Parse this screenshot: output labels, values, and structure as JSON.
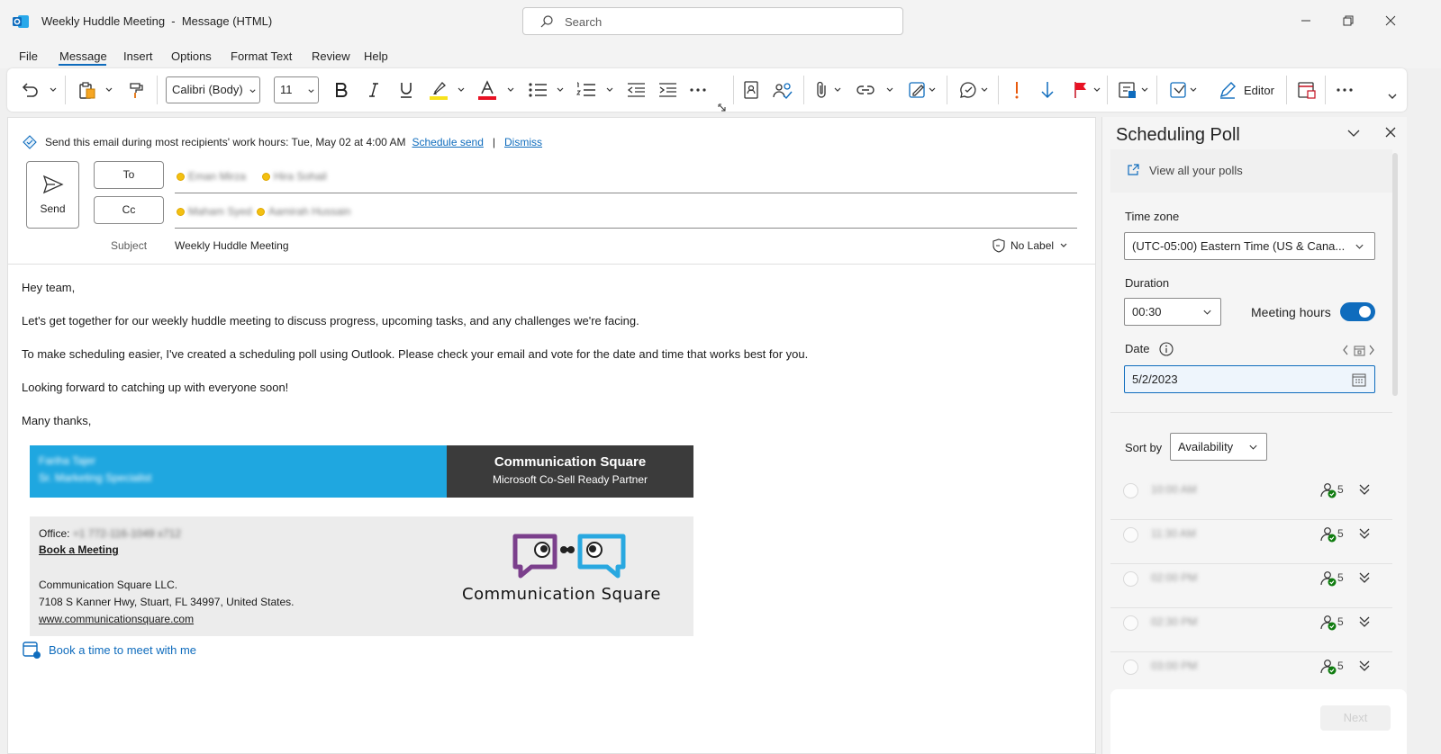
{
  "window": {
    "title": "Weekly Huddle Meeting  -  Message (HTML)",
    "search_placeholder": "Search"
  },
  "menu": {
    "tabs": [
      "File",
      "Message",
      "Insert",
      "Options",
      "Format Text",
      "Review",
      "Help"
    ],
    "active_tab": "Message"
  },
  "ribbon": {
    "font_name": "Calibri (Body)",
    "font_size": "11",
    "editor_label": "Editor",
    "highlight_color": "#f7e21c",
    "font_color": "#e81123"
  },
  "compose": {
    "send_suggestion": "Send this email during most recipients' work hours: Tue, May 02 at 4:00 AM",
    "schedule_send": "Schedule send",
    "divider": "|",
    "dismiss": "Dismiss",
    "send_label": "Send",
    "to_label": "To",
    "cc_label": "Cc",
    "to_recipients": [
      "Eman Mirza",
      "Hira Sohail"
    ],
    "cc_recipients": [
      "Maham Syed",
      "Aamirah Hussain"
    ],
    "subject_label": "Subject",
    "subject": "Weekly Huddle Meeting",
    "sensitivity_label": "No Label"
  },
  "body": {
    "greeting": "Hey team,",
    "para1": "Let's get together for our weekly huddle meeting to discuss progress, upcoming tasks, and any challenges we're facing.",
    "para2": "To make scheduling easier, I've created a scheduling poll using Outlook. Please check your email and vote for the date and time that works best for you.",
    "para3": "Looking forward to catching up with everyone soon!",
    "closing": "Many thanks,"
  },
  "signature": {
    "name": "Fariha Tajer",
    "role": "Sr. Marketing Specialist",
    "company_heading": "Communication Square",
    "company_tagline": "Microsoft Co-Sell Ready Partner",
    "office_label": "Office:",
    "office_phone": "+1 772-116-1049 x712",
    "book_meeting": "Book a Meeting",
    "company_name": "Communication Square LLC.",
    "address": "7108 S Kanner Hwy, Stuart, FL 34997, United States.",
    "website": "www.communicationsquare.com",
    "logo_text": "Communication Square",
    "book_time": "Book a time to meet with me"
  },
  "panel": {
    "title": "Scheduling Poll",
    "view_polls": "View all your polls",
    "timezone_label": "Time zone",
    "timezone_value": "(UTC-05:00) Eastern Time (US & Cana...",
    "duration_label": "Duration",
    "duration_value": "00:30",
    "meeting_hours_label": "Meeting hours",
    "meeting_hours_on": true,
    "date_label": "Date",
    "date_value": "5/2/2023",
    "sort_label": "Sort by",
    "sort_value": "Availability",
    "slots": [
      {
        "time": "10:00 AM",
        "count": "5"
      },
      {
        "time": "11:30 AM",
        "count": "5"
      },
      {
        "time": "02:00 PM",
        "count": "5"
      },
      {
        "time": "02:30 PM",
        "count": "5"
      },
      {
        "time": "03:00 PM",
        "count": "5"
      }
    ],
    "next_label": "Next"
  }
}
